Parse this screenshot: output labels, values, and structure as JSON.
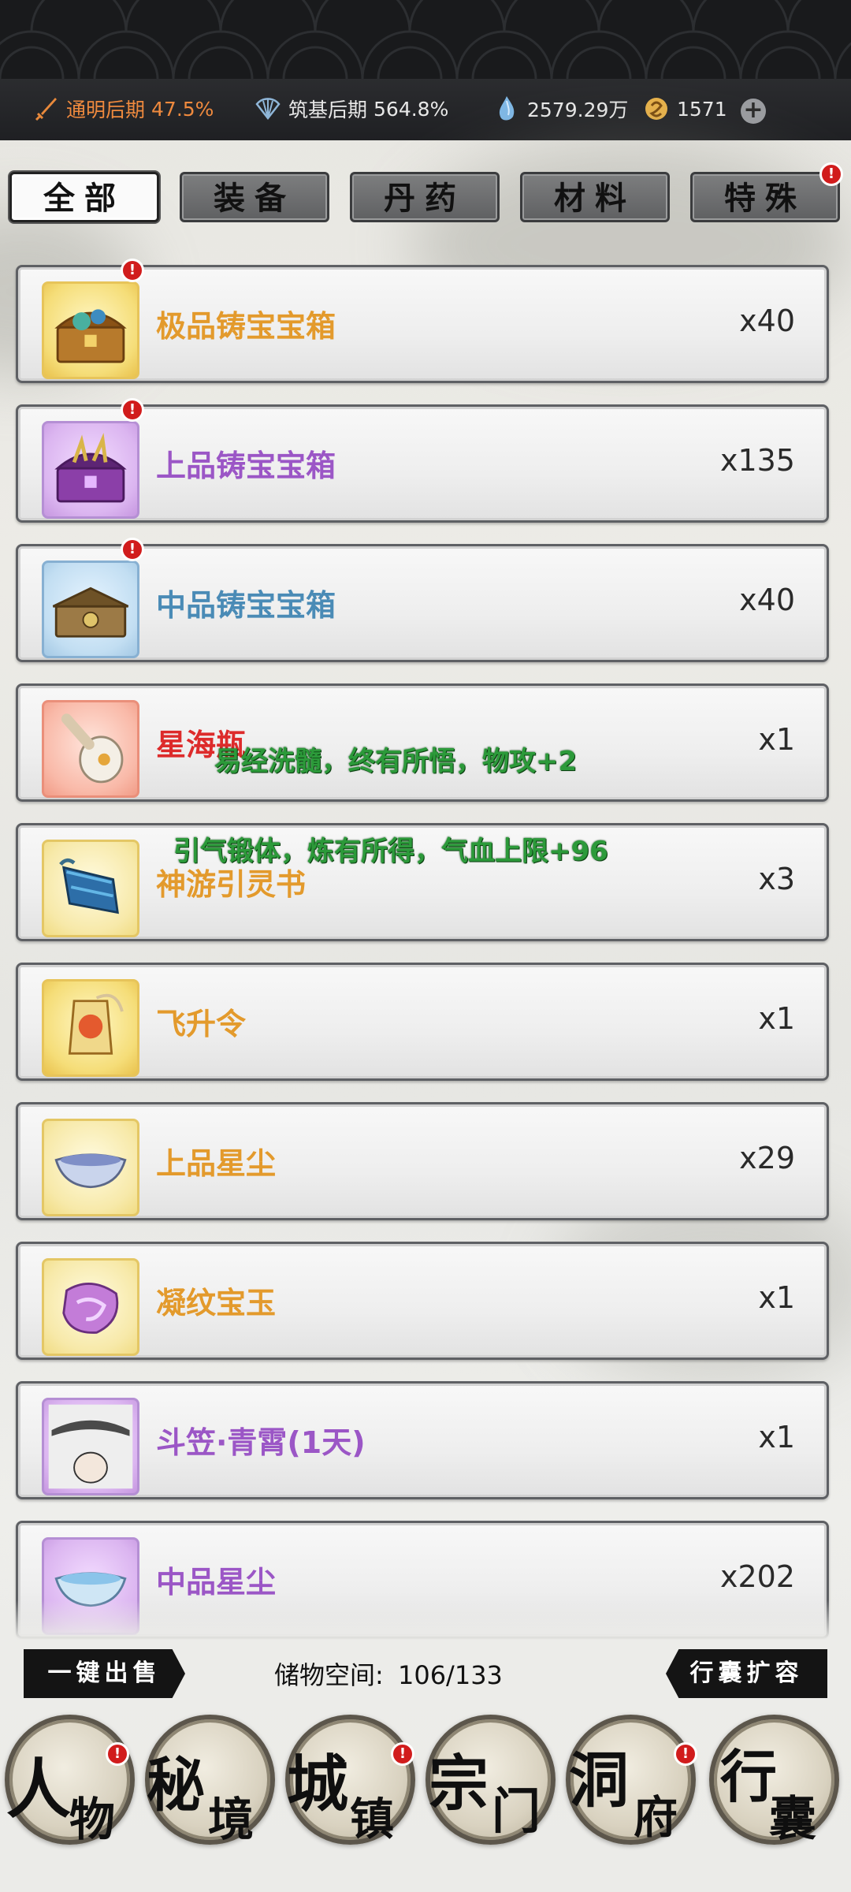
{
  "status": {
    "stat1": {
      "label": "通明后期",
      "value": "47.5%",
      "icon": "sword-icon"
    },
    "stat2": {
      "label": "筑基后期",
      "value": "564.8%",
      "icon": "fan-icon"
    },
    "spirit_stones": "2579.29万",
    "currency": "1571"
  },
  "tabs": [
    {
      "label": "全部"
    },
    {
      "label": "装备"
    },
    {
      "label": "丹药"
    },
    {
      "label": "材料"
    },
    {
      "label": "特殊"
    }
  ],
  "items": [
    {
      "name": "极品铸宝宝箱",
      "count": "x40",
      "color": "#e39a2c",
      "icon": "treasure-chest-icon"
    },
    {
      "name": "上品铸宝宝箱",
      "count": "x135",
      "color": "#9b56c6",
      "icon": "treasure-chest-icon"
    },
    {
      "name": "中品铸宝宝箱",
      "count": "x40",
      "color": "#4a8bb6",
      "icon": "treasure-chest-icon"
    },
    {
      "name": "星海瓶",
      "count": "x1",
      "color": "#dd2b2b",
      "icon": "gourd-bottle-icon"
    },
    {
      "name": "神游引灵书",
      "count": "x3",
      "color": "#e39a2c",
      "icon": "scroll-icon"
    },
    {
      "name": "飞升令",
      "count": "x1",
      "color": "#e39a2c",
      "icon": "token-icon"
    },
    {
      "name": "上品星尘",
      "count": "x29",
      "color": "#e39a2c",
      "icon": "stardust-icon"
    },
    {
      "name": "凝纹宝玉",
      "count": "x1",
      "color": "#e39a2c",
      "icon": "jade-icon"
    },
    {
      "name": "斗笠·青霄(1天)",
      "count": "x1",
      "color": "#9b56c6",
      "icon": "bamboo-hat-icon"
    },
    {
      "name": "中品星尘",
      "count": "x202",
      "color": "#9b56c6",
      "icon": "stardust-icon"
    }
  ],
  "float_messages": [
    "易经洗髓，终有所悟，物攻+2",
    "引气锻体，炼有所得，气血上限+96"
  ],
  "bottom": {
    "sell_all": "一键出售",
    "storage_label": "储物空间:",
    "storage_value": "106/133",
    "expand": "行囊扩容"
  },
  "nav": [
    {
      "line1": "人",
      "line2": "物"
    },
    {
      "line1": "秘",
      "line2": "境"
    },
    {
      "line1": "城",
      "line2": "镇"
    },
    {
      "line1": "宗",
      "line2": "门"
    },
    {
      "line1": "洞",
      "line2": "府"
    },
    {
      "line1": "行",
      "line2": "囊"
    }
  ],
  "badge_mark": "!"
}
